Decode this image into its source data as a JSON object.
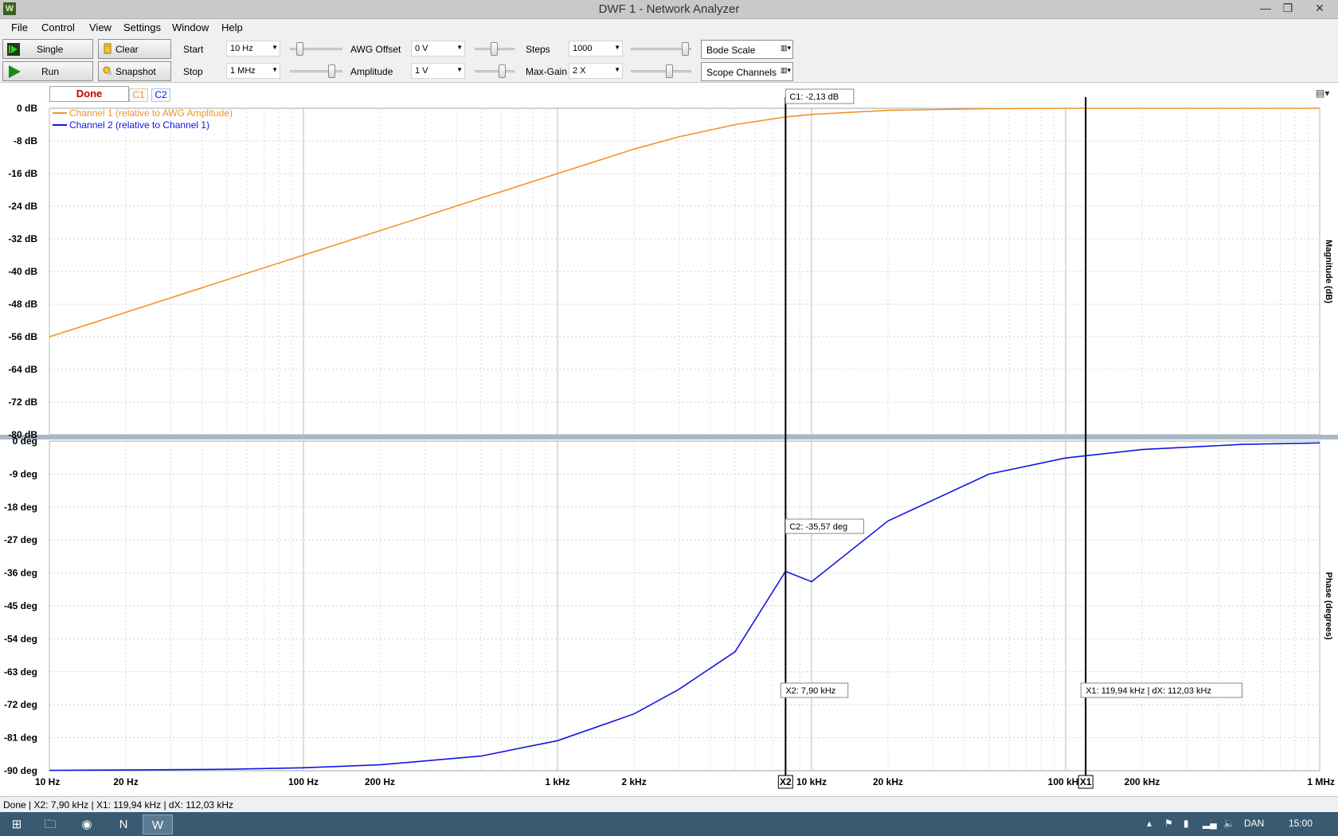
{
  "window": {
    "title": "DWF 1 - Network Analyzer",
    "minimize_glyph": "—",
    "restore_glyph": "❐",
    "close_glyph": "✕"
  },
  "menu": [
    "File",
    "Control",
    "View",
    "Settings",
    "Window",
    "Help"
  ],
  "toolbar": {
    "single_label": "Single",
    "run_label": "Run",
    "clear_label": "Clear",
    "snapshot_label": "Snapshot",
    "start_label": "Start",
    "start_value": "10 Hz",
    "stop_label": "Stop",
    "stop_value": "1 MHz",
    "awg_offset_label": "AWG Offset",
    "awg_offset_value": "0 V",
    "amplitude_label": "Amplitude",
    "amplitude_value": "1 V",
    "steps_label": "Steps",
    "steps_value": "1000",
    "max_gain_label": "Max-Gain",
    "max_gain_value": "2 X",
    "bode_scale_label": "Bode Scale",
    "scope_channels_label": "Scope Channels"
  },
  "tabs": {
    "status": "Done",
    "c1": "C1",
    "c2": "C2"
  },
  "colors": {
    "channel1": "#f39425",
    "channel2": "#1414e6",
    "status_done": "#c00000"
  },
  "chart_data": {
    "type": "line",
    "xscale": "log",
    "xlim": [
      10,
      1000000
    ],
    "x_ticks": [
      "10 Hz",
      "20 Hz",
      "100 Hz",
      "200 Hz",
      "1 kHz",
      "2 kHz",
      "10 kHz",
      "20 kHz",
      "100 kHz",
      "200 kHz",
      "1 MHz"
    ],
    "panels": [
      {
        "name": "magnitude",
        "ylabel": "Magnitude (dB)",
        "ylim": [
          -80,
          0
        ],
        "y_ticks": [
          "0 dB",
          "-8 dB",
          "-16 dB",
          "-24 dB",
          "-32 dB",
          "-40 dB",
          "-48 dB",
          "-56 dB",
          "-64 dB",
          "-72 dB",
          "-80 dB"
        ],
        "series": [
          {
            "name": "Channel 1 (relative to AWG Amplitude)",
            "color": "#f39425",
            "x": [
              10,
              20,
              50,
              100,
              200,
              500,
              1000,
              2000,
              3000,
              5000,
              7900,
              10000,
              20000,
              50000,
              100000,
              200000,
              500000,
              1000000
            ],
            "y": [
              -56,
              -50,
              -42,
              -36,
              -30,
              -22,
              -16,
              -10,
              -7,
              -4,
              -2.13,
              -1.5,
              -0.5,
              -0.1,
              0,
              0,
              0,
              0
            ]
          }
        ]
      },
      {
        "name": "phase",
        "ylabel": "Phase (degrees)",
        "ylim": [
          -90,
          0
        ],
        "y_ticks": [
          "0 deg",
          "-9 deg",
          "-18 deg",
          "-27 deg",
          "-36 deg",
          "-45 deg",
          "-54 deg",
          "-63 deg",
          "-72 deg",
          "-81 deg",
          "-90 deg"
        ],
        "series": [
          {
            "name": "Channel 2 (relative to Channel 1)",
            "color": "#1414e6",
            "x": [
              10,
              20,
              50,
              100,
              200,
              500,
              1000,
              2000,
              3000,
              5000,
              7900,
              10000,
              20000,
              50000,
              100000,
              200000,
              500000,
              1000000
            ],
            "y": [
              -89.9,
              -89.8,
              -89.6,
              -89.2,
              -88.4,
              -86,
              -81.8,
              -74.5,
              -67.8,
              -57.5,
              -35.57,
              -38.4,
              -21.8,
              -9.0,
              -4.6,
              -2.3,
              -0.9,
              -0.5
            ]
          }
        ]
      }
    ],
    "cursors": [
      {
        "name": "X2",
        "x": 7900,
        "label": "X2: 7,90 kHz"
      },
      {
        "name": "X1",
        "x": 119940,
        "label": "X1: 119,94 kHz | dX: 112,03 kHz"
      }
    ],
    "annotations": [
      "C1: -2,13 dB",
      "C2: -35,57 deg"
    ],
    "legend_position": "top-left",
    "grid": true
  },
  "statusbar": {
    "text": "Done  |  X2: 7,90 kHz | X1: 119,94 kHz | dX: 112,03 kHz"
  },
  "taskbar": {
    "tray_language": "DAN",
    "tray_time": "15:00"
  }
}
